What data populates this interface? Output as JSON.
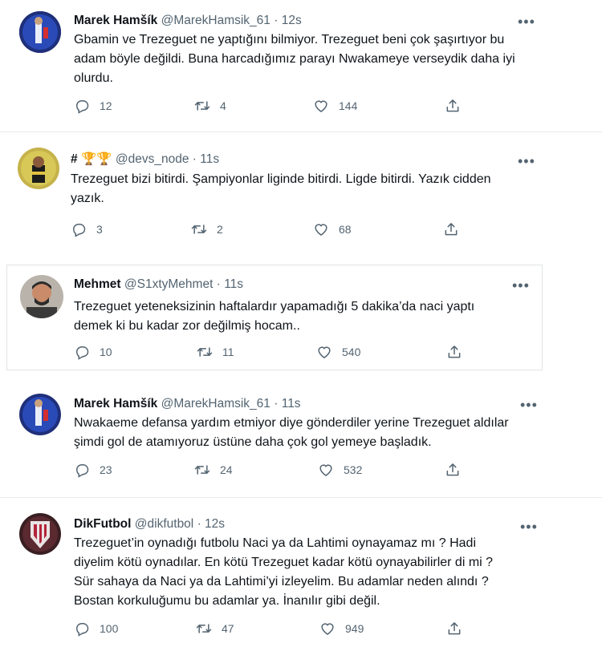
{
  "tweets": [
    {
      "name": "Marek Hamšík",
      "handle": "@MarekHamsik_61",
      "time": "12s",
      "dot": "·",
      "text": "Gbamin ve Trezeguet ne yaptığını bilmiyor. Trezeguet beni çok şaşırtıyor bu\nadam böyle değildi. Buna harcadığımız parayı Nwakameye verseydik daha iyi\nolurdu.",
      "replies": "12",
      "retweets": "4",
      "likes": "144"
    },
    {
      "name": "#",
      "handle": "@devs_node",
      "time": "11s",
      "dot": "·",
      "name_emoji": "🏆🏆",
      "text": "Trezeguet bizi bitirdi. Şampiyonlar liginde bitirdi. Ligde bitirdi. Yazık cidden\nyazık.",
      "replies": "3",
      "retweets": "2",
      "likes": "68"
    },
    {
      "name": "Mehmet",
      "handle": "@S1xtyMehmet",
      "time": "11s",
      "dot": "·",
      "text": "Trezeguet yeteneksizinin haftalardır yapamadığı 5 dakika’da naci yaptı\ndemek ki bu kadar zor değilmiş hocam..",
      "replies": "10",
      "retweets": "11",
      "likes": "540"
    },
    {
      "name": "Marek Hamšík",
      "handle": "@MarekHamsik_61",
      "time": "11s",
      "dot": "·",
      "text": "Nwakaeme defansa yardım etmiyor diye gönderdiler yerine Trezeguet aldılar\nşimdi gol de atamıyoruz üstüne daha çok gol yemeye başladık.",
      "replies": "23",
      "retweets": "24",
      "likes": "532"
    },
    {
      "name": "DikFutbol",
      "handle": "@dikfutbol",
      "time": "12s",
      "dot": "·",
      "text": "Trezeguet’in oynadığı futbolu Naci ya da Lahtimi oynayamaz mı ? Hadi\ndiyelim kötü oynadılar. En kötü Trezeguet kadar kötü oynayabilirler di mi ?\nSür sahaya da Naci ya da Lahtimi’yi izleyelim. Bu adamlar neden alındı ?\nBostan korkuluğumu bu adamlar ya. İnanılır gibi değil.",
      "replies": "100",
      "retweets": "47",
      "likes": "949"
    }
  ],
  "icons": {
    "reply": "reply-icon",
    "retweet": "retweet-icon",
    "like": "heart-icon",
    "share": "share-icon",
    "more": "more-icon"
  },
  "more_glyph": "•••"
}
